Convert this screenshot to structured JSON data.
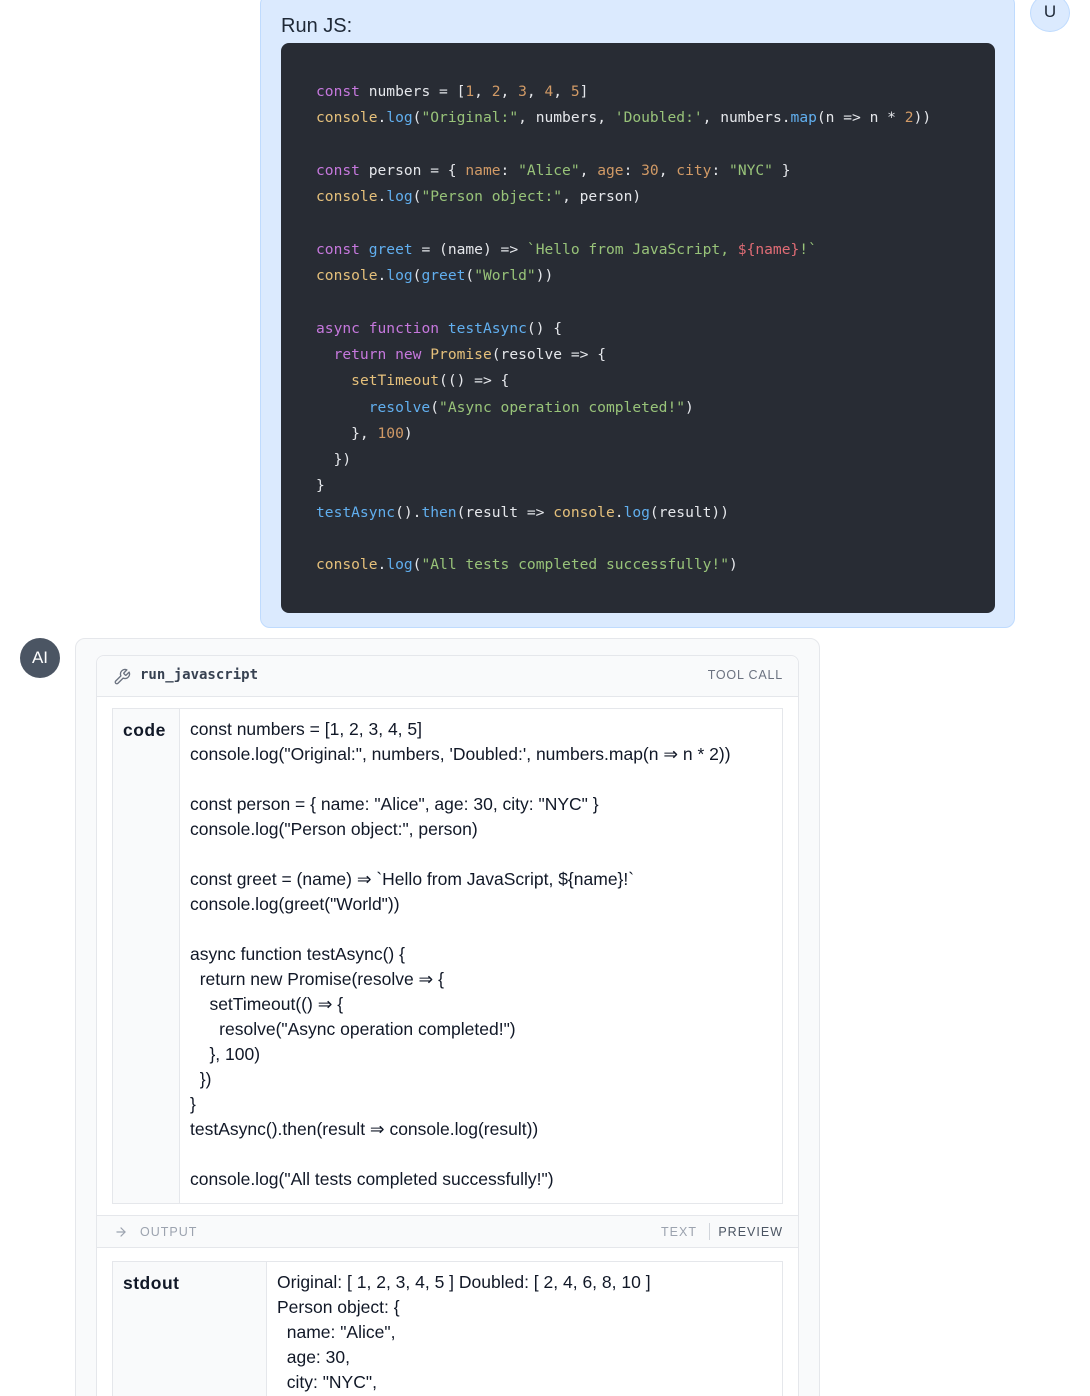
{
  "user": {
    "avatar": "U",
    "title": "Run JS:"
  },
  "ai": {
    "avatar": "AI"
  },
  "tool": {
    "icon": "wrench-icon",
    "name": "run_javascript",
    "badge": "TOOL CALL",
    "arg_key": "code",
    "arg_lines": [
      "const numbers = [1, 2, 3, 4, 5]",
      "console.log(\"Original:\", numbers, 'Doubled:', numbers.map(n ⇒ n * 2))",
      "",
      "const person = { name: \"Alice\", age: 30, city: \"NYC\" }",
      "console.log(\"Person object:\", person)",
      "",
      "const greet = (name) ⇒ `Hello from JavaScript, ${name}!`",
      "console.log(greet(\"World\"))",
      "",
      "async function testAsync() {",
      "  return new Promise(resolve ⇒ {",
      "    setTimeout(() ⇒ {",
      "      resolve(\"Async operation completed!\")",
      "    }, 100)",
      "  })",
      "}",
      "testAsync().then(result ⇒ console.log(result))",
      "",
      "console.log(\"All tests completed successfully!\")"
    ]
  },
  "output": {
    "icon": "arrow-right-icon",
    "label": "OUTPUT",
    "mode_text": "TEXT",
    "mode_preview": "PREVIEW",
    "key": "stdout",
    "lines": [
      "Original: [ 1, 2, 3, 4, 5 ] Doubled: [ 2, 4, 6, 8, 10 ]",
      "Person object: {",
      "  name: \"Alice\",",
      "  age: 30,",
      "  city: \"NYC\","
    ]
  },
  "code_block": {
    "language": "javascript",
    "lines": [
      [
        [
          "kw",
          "const"
        ],
        [
          "tx",
          " numbers = ["
        ],
        [
          "nm",
          "1"
        ],
        [
          "tx",
          ", "
        ],
        [
          "nm",
          "2"
        ],
        [
          "tx",
          ", "
        ],
        [
          "nm",
          "3"
        ],
        [
          "tx",
          ", "
        ],
        [
          "nm",
          "4"
        ],
        [
          "tx",
          ", "
        ],
        [
          "nm",
          "5"
        ],
        [
          "tx",
          "]"
        ]
      ],
      [
        [
          "cn",
          "console"
        ],
        [
          "tx",
          "."
        ],
        [
          "fn",
          "log"
        ],
        [
          "tx",
          "("
        ],
        [
          "st",
          "\"Original:\""
        ],
        [
          "tx",
          ", numbers, "
        ],
        [
          "st",
          "'Doubled:'"
        ],
        [
          "tx",
          ", numbers."
        ],
        [
          "fn",
          "map"
        ],
        [
          "tx",
          "(n => n * "
        ],
        [
          "nm",
          "2"
        ],
        [
          "tx",
          "))"
        ]
      ],
      [],
      [
        [
          "kw",
          "const"
        ],
        [
          "tx",
          " person = { "
        ],
        [
          "pr",
          "name"
        ],
        [
          "tx",
          ": "
        ],
        [
          "st",
          "\"Alice\""
        ],
        [
          "tx",
          ", "
        ],
        [
          "pr",
          "age"
        ],
        [
          "tx",
          ": "
        ],
        [
          "nm",
          "30"
        ],
        [
          "tx",
          ", "
        ],
        [
          "pr",
          "city"
        ],
        [
          "tx",
          ": "
        ],
        [
          "st",
          "\"NYC\""
        ],
        [
          "tx",
          " }"
        ]
      ],
      [
        [
          "cn",
          "console"
        ],
        [
          "tx",
          "."
        ],
        [
          "fn",
          "log"
        ],
        [
          "tx",
          "("
        ],
        [
          "st",
          "\"Person object:\""
        ],
        [
          "tx",
          ", person)"
        ]
      ],
      [],
      [
        [
          "kw",
          "const"
        ],
        [
          "tx",
          " "
        ],
        [
          "fn",
          "greet"
        ],
        [
          "tx",
          " = (name) => "
        ],
        [
          "st",
          "`Hello from JavaScript, "
        ],
        [
          "tp",
          "${name}"
        ],
        [
          "st",
          "!`"
        ]
      ],
      [
        [
          "cn",
          "console"
        ],
        [
          "tx",
          "."
        ],
        [
          "fn",
          "log"
        ],
        [
          "tx",
          "("
        ],
        [
          "fn",
          "greet"
        ],
        [
          "tx",
          "("
        ],
        [
          "st",
          "\"World\""
        ],
        [
          "tx",
          "))"
        ]
      ],
      [],
      [
        [
          "kw",
          "async"
        ],
        [
          "tx",
          " "
        ],
        [
          "kw",
          "function"
        ],
        [
          "tx",
          " "
        ],
        [
          "fn",
          "testAsync"
        ],
        [
          "tx",
          "() {"
        ]
      ],
      [
        [
          "tx",
          "  "
        ],
        [
          "kw",
          "return"
        ],
        [
          "tx",
          " "
        ],
        [
          "kw",
          "new"
        ],
        [
          "tx",
          " "
        ],
        [
          "cn",
          "Promise"
        ],
        [
          "tx",
          "(resolve => {"
        ]
      ],
      [
        [
          "tx",
          "    "
        ],
        [
          "cn",
          "setTimeout"
        ],
        [
          "tx",
          "(() => {"
        ]
      ],
      [
        [
          "tx",
          "      "
        ],
        [
          "fn",
          "resolve"
        ],
        [
          "tx",
          "("
        ],
        [
          "st",
          "\"Async operation completed!\""
        ],
        [
          "tx",
          ")"
        ]
      ],
      [
        [
          "tx",
          "    }, "
        ],
        [
          "nm",
          "100"
        ],
        [
          "tx",
          ")"
        ]
      ],
      [
        [
          "tx",
          "  })"
        ]
      ],
      [
        [
          "tx",
          "}"
        ]
      ],
      [
        [
          "fn",
          "testAsync"
        ],
        [
          "tx",
          "()."
        ],
        [
          "fn",
          "then"
        ],
        [
          "tx",
          "(result => "
        ],
        [
          "cn",
          "console"
        ],
        [
          "tx",
          "."
        ],
        [
          "fn",
          "log"
        ],
        [
          "tx",
          "(result))"
        ]
      ],
      [],
      [
        [
          "cn",
          "console"
        ],
        [
          "tx",
          "."
        ],
        [
          "fn",
          "log"
        ],
        [
          "tx",
          "("
        ],
        [
          "st",
          "\"All tests completed successfully!\""
        ],
        [
          "tx",
          ")"
        ]
      ]
    ]
  }
}
